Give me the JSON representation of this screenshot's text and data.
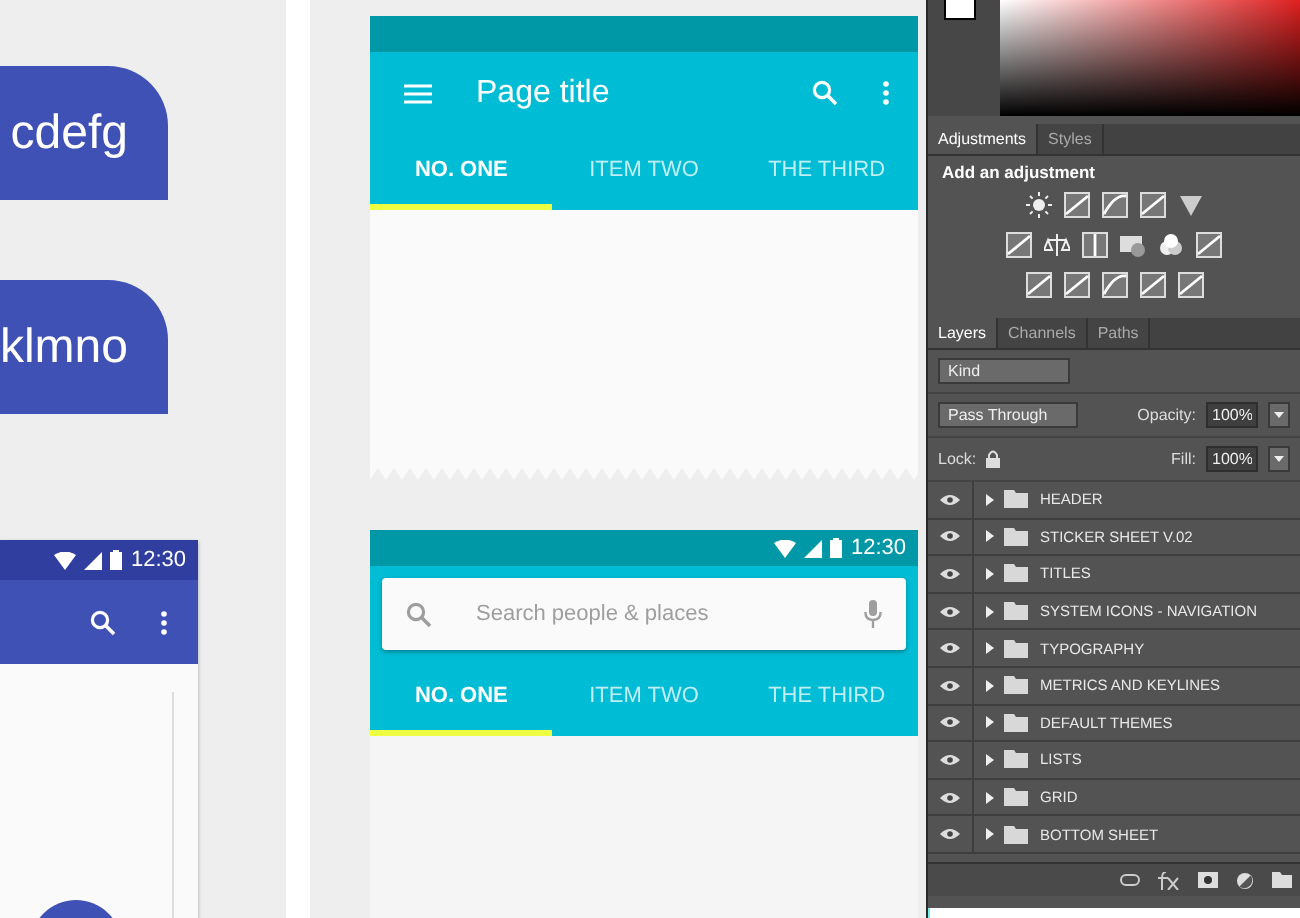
{
  "canvas": {
    "chips": [
      {
        "label": "cdefg"
      },
      {
        "label": "klmno"
      }
    ],
    "phone_left": {
      "status_time": "12:30"
    },
    "artboard_1": {
      "title": "Page title",
      "tabs": [
        {
          "label": "NO. ONE",
          "selected": true
        },
        {
          "label": "ITEM TWO",
          "selected": false
        },
        {
          "label": "THE THIRD",
          "selected": false
        }
      ]
    },
    "artboard_2": {
      "status_time": "12:30",
      "search": {
        "placeholder": "Search people & places"
      },
      "tabs": [
        {
          "label": "NO. ONE",
          "selected": true
        },
        {
          "label": "ITEM TWO",
          "selected": false
        },
        {
          "label": "THE THIRD",
          "selected": false
        }
      ]
    }
  },
  "panel": {
    "adjustments": {
      "tabs": [
        {
          "label": "Adjustments",
          "selected": true
        },
        {
          "label": "Styles",
          "selected": false
        }
      ],
      "heading": "Add an adjustment"
    },
    "layers": {
      "tabs": [
        {
          "label": "Layers",
          "selected": true
        },
        {
          "label": "Channels",
          "selected": false
        },
        {
          "label": "Paths",
          "selected": false
        }
      ],
      "filter": "Kind",
      "blend_mode": "Pass Through",
      "opacity_label": "Opacity:",
      "opacity": "100%",
      "lock_label": "Lock:",
      "fill_label": "Fill:",
      "fill": "100%",
      "items": [
        {
          "name": "HEADER",
          "visible": true
        },
        {
          "name": "STICKER SHEET V.02",
          "visible": true
        },
        {
          "name": "TITLES",
          "visible": true
        },
        {
          "name": "SYSTEM ICONS - NAVIGATION",
          "visible": true
        },
        {
          "name": "TYPOGRAPHY",
          "visible": true
        },
        {
          "name": "METRICS AND KEYLINES",
          "visible": true
        },
        {
          "name": "DEFAULT THEMES",
          "visible": true
        },
        {
          "name": "LISTS",
          "visible": true
        },
        {
          "name": "GRID",
          "visible": true
        },
        {
          "name": "BOTTOM SHEET",
          "visible": true
        }
      ]
    }
  }
}
